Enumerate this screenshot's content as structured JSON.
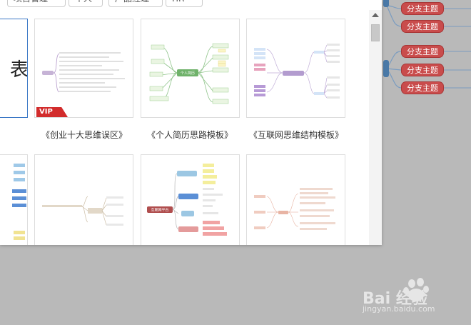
{
  "category_tags": [
    "项目管理",
    "个人",
    "产品经理",
    "HR"
  ],
  "background_mindmap": {
    "nodes": [
      "分支主题",
      "分支主题",
      "分支主题",
      "分支主题",
      "分支主题"
    ]
  },
  "templates": {
    "row1": [
      {
        "caption": "",
        "partial_char": "表",
        "selected": true
      },
      {
        "caption": "《创业十大思维误区》",
        "vip": true,
        "vip_label": "VIP"
      },
      {
        "caption": "《个人简历思路模板》"
      },
      {
        "caption": "《互联网思维结构模板》"
      }
    ],
    "row2": [
      {
        "caption": ""
      },
      {
        "caption": "",
        "vip": true
      },
      {
        "caption": ""
      },
      {
        "caption": ""
      }
    ]
  },
  "thumb_texts": {
    "resume_center": "个人简历",
    "platform_center": "互联网平台"
  },
  "watermark": {
    "brand": "Bai  经验",
    "url": "jingyan.baidu.com"
  },
  "colors": {
    "branch_red": "#c94c4c",
    "vip_red": "#d22c2c",
    "selected_blue": "#3b78c6"
  }
}
